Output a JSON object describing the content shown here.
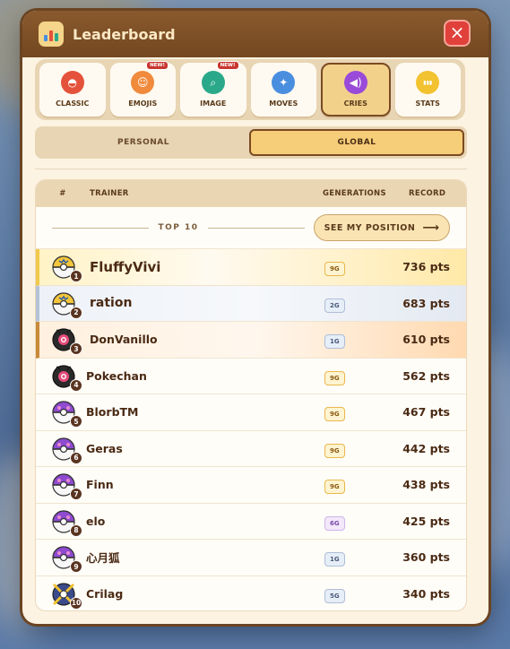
{
  "header": {
    "title": "Leaderboard",
    "close_icon": "×"
  },
  "tabs": [
    {
      "label": "CLASSIC",
      "icon": "pokeball-icon",
      "color": "#e4523b",
      "badge": ""
    },
    {
      "label": "EMOJIS",
      "icon": "smiley-icon",
      "color": "#f08a3c",
      "badge": "NEW!"
    },
    {
      "label": "IMAGE",
      "icon": "magnifier-icon",
      "color": "#2aa88a",
      "badge": "NEW!"
    },
    {
      "label": "MOVES",
      "icon": "sparkle-icon",
      "color": "#4a8ee0",
      "badge": ""
    },
    {
      "label": "CRIES",
      "icon": "speaker-icon",
      "color": "#9a4ad8",
      "badge": "",
      "active": true
    },
    {
      "label": "STATS",
      "icon": "stats-bars-icon",
      "color": "#f2c230",
      "badge": ""
    }
  ],
  "scope": {
    "personal": "PERSONAL",
    "global": "GLOBAL",
    "selected": "GLOBAL"
  },
  "table": {
    "col_rank": "#",
    "col_trainer": "TRAINER",
    "col_generations": "GENERATIONS",
    "col_record": "RECORD",
    "top_label": "TOP 10",
    "see_position": "SEE MY POSITION",
    "see_arrow": "⟶"
  },
  "rows": [
    {
      "rank": "1",
      "name": "FluffyVivi",
      "gen": "9G",
      "pts": "736 pts",
      "ball": "quick",
      "gen_color": "gold"
    },
    {
      "rank": "2",
      "name": "ration",
      "gen": "2G",
      "pts": "683 pts",
      "ball": "quick",
      "gen_color": "blue"
    },
    {
      "rank": "3",
      "name": "DonVanillo",
      "gen": "1G",
      "pts": "610 pts",
      "ball": "dusk",
      "gen_color": "blue"
    },
    {
      "rank": "4",
      "name": "Pokechan",
      "gen": "9G",
      "pts": "562 pts",
      "ball": "dusk",
      "gen_color": "gold"
    },
    {
      "rank": "5",
      "name": "BlorbTM",
      "gen": "9G",
      "pts": "467 pts",
      "ball": "master",
      "gen_color": "gold"
    },
    {
      "rank": "6",
      "name": "Geras",
      "gen": "9G",
      "pts": "442 pts",
      "ball": "master",
      "gen_color": "gold"
    },
    {
      "rank": "7",
      "name": "Finn",
      "gen": "9G",
      "pts": "438 pts",
      "ball": "master",
      "gen_color": "gold"
    },
    {
      "rank": "8",
      "name": "elo",
      "gen": "6G",
      "pts": "425 pts",
      "ball": "master",
      "gen_color": "purple"
    },
    {
      "rank": "9",
      "name": "心月狐",
      "gen": "1G",
      "pts": "360 pts",
      "ball": "master",
      "gen_color": "blue"
    },
    {
      "rank": "10",
      "name": "Crilag",
      "gen": "5G",
      "pts": "340 pts",
      "ball": "crossed",
      "gen_color": "blue"
    }
  ]
}
